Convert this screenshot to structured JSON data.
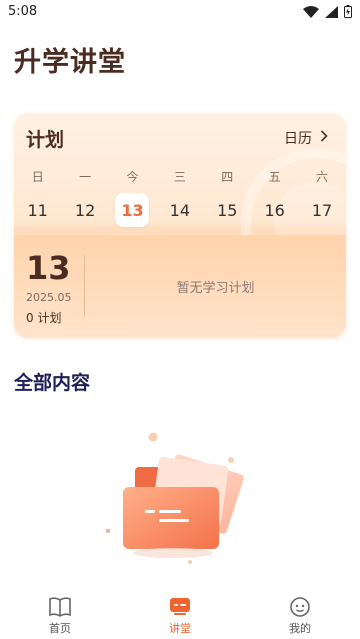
{
  "status_bar": {
    "time": "5:08",
    "icons": [
      "wifi-icon",
      "signal-icon",
      "battery-icon"
    ]
  },
  "header": {
    "title": "升学讲堂"
  },
  "plan_card": {
    "title": "计划",
    "calendar_link": "日历",
    "days": [
      {
        "weekday": "日",
        "date": "11"
      },
      {
        "weekday": "一",
        "date": "12"
      },
      {
        "weekday": "今",
        "date": "13",
        "selected": true
      },
      {
        "weekday": "三",
        "date": "14"
      },
      {
        "weekday": "四",
        "date": "15"
      },
      {
        "weekday": "五",
        "date": "16"
      },
      {
        "weekday": "六",
        "date": "17"
      }
    ],
    "selected_day": "13",
    "year_month": "2025.05",
    "plan_count": "0 计划",
    "empty_text": "暂无学习计划"
  },
  "section": {
    "title": "全部内容"
  },
  "bottom_nav": [
    {
      "label": "首页",
      "icon": "book-icon"
    },
    {
      "label": "讲堂",
      "icon": "lecture-icon",
      "active": true
    },
    {
      "label": "我的",
      "icon": "profile-face-icon"
    }
  ],
  "colors": {
    "accent": "#f0642f",
    "title": "#4a2c22",
    "section_title": "#1f1e5a",
    "card_bg": "#ffe8d2"
  }
}
